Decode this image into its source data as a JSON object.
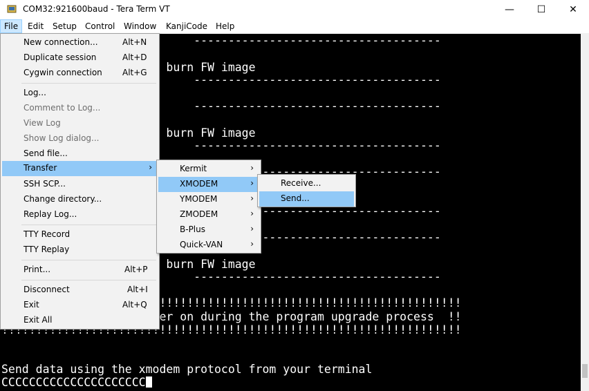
{
  "window": {
    "title": "COM32:921600baud - Tera Term VT",
    "min_glyph": "—",
    "max_glyph": "☐",
    "close_glyph": "✕"
  },
  "menubar": {
    "items": [
      "File",
      "Edit",
      "Setup",
      "Control",
      "Window",
      "KanjiCode",
      "Help"
    ]
  },
  "terminal": {
    "lines": [
      "                            ------------------------------------",
      "                        burn FW image",
      "                            ------------------------------------",
      "",
      "                            ------------------------------------",
      "                        burn FW image",
      "                            ------------------------------------",
      "",
      "                            ------------------------------------",
      "",
      "                            ------------------------------------",
      "",
      "                            ------------------------------------",
      "",
      "                            ------------------------------------",
      "                        burn FW image",
      "                            ------------------------------------",
      "",
      "                       !!!!!!!!!!!!!!!!!!!!!!!!!!!!!!!!!!!!!!!!!!!!",
      "                       er on during the program upgrade process  !!",
      "!!!!!!!!!!!!!!!!!!!!!!!!!!!!!!!!!!!!!!!!!!!!!!!!!!!!!!!!!!!!!!!!!!!",
      "",
      "",
      "Send data using the xmodem protocol from your terminal",
      "CCCCCCCCCCCCCCCCCCCCC"
    ]
  },
  "file_menu": {
    "items": [
      {
        "label": "New connection...",
        "accel": "Alt+N"
      },
      {
        "label": "Duplicate session",
        "accel": "Alt+D"
      },
      {
        "label": "Cygwin connection",
        "accel": "Alt+G"
      },
      {
        "label": "Log..."
      },
      {
        "label": "Comment to Log..."
      },
      {
        "label": "View Log"
      },
      {
        "label": "Show Log dialog..."
      },
      {
        "label": "Send file..."
      },
      {
        "label": "Transfer",
        "arrow": "›"
      },
      {
        "label": "SSH SCP..."
      },
      {
        "label": "Change directory..."
      },
      {
        "label": "Replay Log..."
      },
      {
        "label": "TTY Record"
      },
      {
        "label": "TTY Replay"
      },
      {
        "label": "Print...",
        "accel": "Alt+P"
      },
      {
        "label": "Disconnect",
        "accel": "Alt+I"
      },
      {
        "label": "Exit",
        "accel": "Alt+Q"
      },
      {
        "label": "Exit All"
      }
    ]
  },
  "transfer_menu": {
    "items": [
      {
        "label": "Kermit",
        "arrow": "›"
      },
      {
        "label": "XMODEM",
        "arrow": "›"
      },
      {
        "label": "YMODEM",
        "arrow": "›"
      },
      {
        "label": "ZMODEM",
        "arrow": "›"
      },
      {
        "label": "B-Plus",
        "arrow": "›"
      },
      {
        "label": "Quick-VAN",
        "arrow": "›"
      }
    ]
  },
  "xmodem_menu": {
    "items": [
      {
        "label": "Receive..."
      },
      {
        "label": "Send..."
      }
    ]
  }
}
